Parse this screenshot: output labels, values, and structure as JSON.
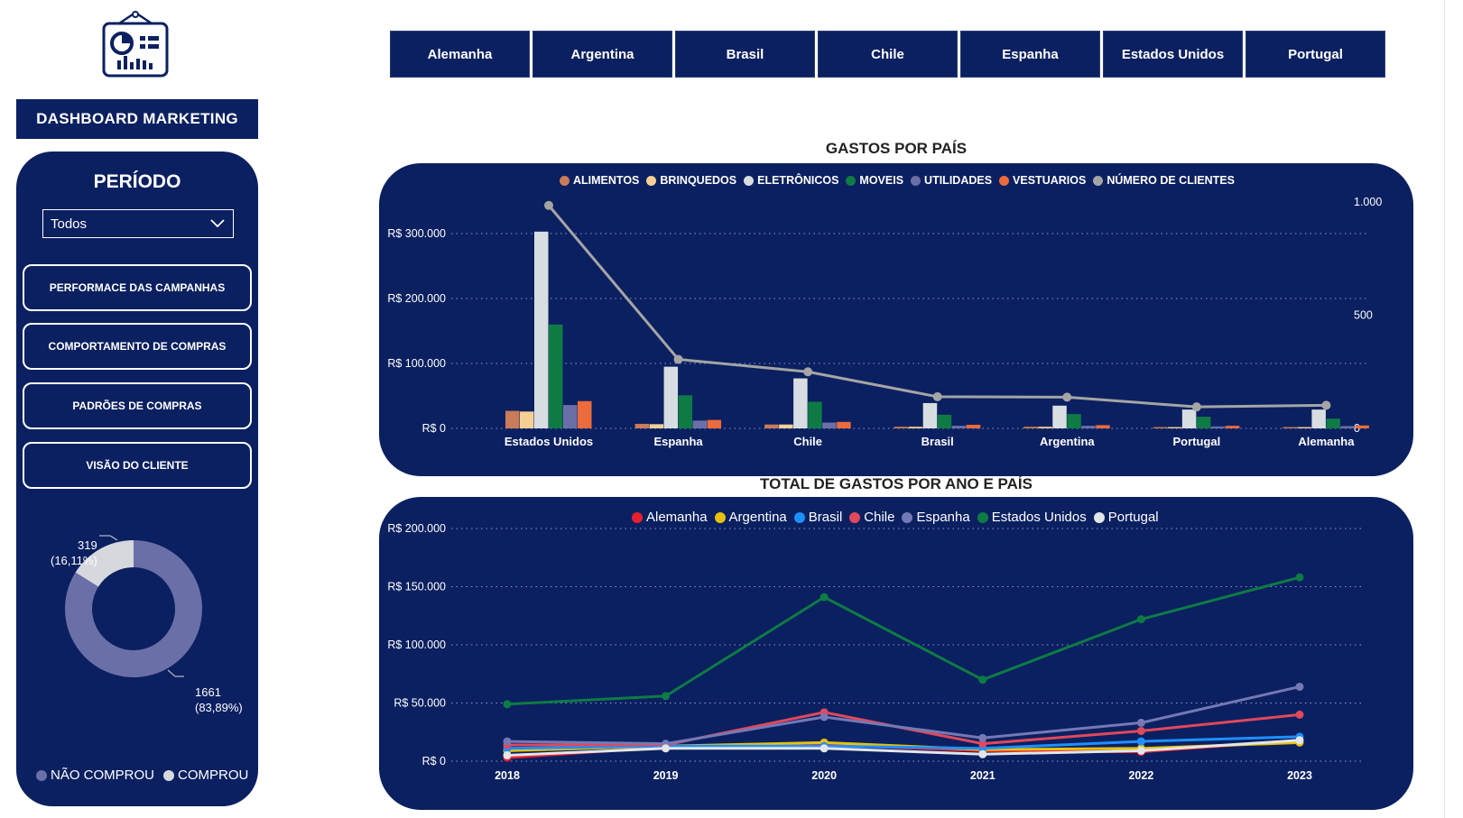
{
  "sidebar": {
    "title": "DASHBOARD MARKETING",
    "periodo_label": "PERÍODO",
    "periodo_value": "Todos",
    "nav": [
      {
        "label": "PERFORMACE DAS CAMPANHAS"
      },
      {
        "label": "COMPORTAMENTO DE COMPRAS"
      },
      {
        "label": "PADRÕES DE COMPRAS"
      },
      {
        "label": "VISÃO DO CLIENTE"
      }
    ],
    "donut": {
      "slices": [
        {
          "name": "NÃO COMPROU",
          "value": 1661,
          "label": "1661",
          "pct": "(83,89%)",
          "color": "#6b6fa8"
        },
        {
          "name": "COMPROU",
          "value": 319,
          "label": "319",
          "pct": "(16,11%)",
          "color": "#d5d9dd"
        }
      ]
    }
  },
  "tabs": [
    "Alemanha",
    "Argentina",
    "Brasil",
    "Chile",
    "Espanha",
    "Estados Unidos",
    "Portugal"
  ],
  "charts": {
    "bar": {
      "title": "GASTOS POR PAÍS"
    },
    "line": {
      "title": "TOTAL DE GASTOS POR ANO E PAÍS"
    }
  },
  "chart_data": [
    {
      "type": "bar",
      "title": "GASTOS POR PAÍS",
      "categories": [
        "Estados Unidos",
        "Espanha",
        "Chile",
        "Brasil",
        "Argentina",
        "Portugal",
        "Alemanha"
      ],
      "series": [
        {
          "name": "ALIMENTOS",
          "color": "#c97b5a",
          "values": [
            27000,
            7000,
            6000,
            2500,
            2500,
            2000,
            2000
          ]
        },
        {
          "name": "BRINQUEDOS",
          "color": "#f5cf95",
          "values": [
            26000,
            6500,
            6000,
            2500,
            2500,
            2000,
            2000
          ]
        },
        {
          "name": "ELETRÔNICOS",
          "color": "#d8dde2",
          "values": [
            303000,
            95000,
            77000,
            39000,
            35000,
            29000,
            29000
          ]
        },
        {
          "name": "MOVEIS",
          "color": "#0e7b45",
          "values": [
            160000,
            51000,
            41000,
            21000,
            22000,
            18000,
            15000
          ]
        },
        {
          "name": "UTILIDADES",
          "color": "#6b6fa8",
          "values": [
            36000,
            12000,
            9000,
            4000,
            4000,
            3000,
            3500
          ]
        },
        {
          "name": "VESTUARIOS",
          "color": "#ec6b3c",
          "values": [
            42000,
            13000,
            10000,
            5500,
            5000,
            4000,
            4500
          ]
        }
      ],
      "line_series": {
        "name": "NÚMERO DE CLIENTES",
        "color": "#a5a5a5",
        "values": [
          985,
          305,
          250,
          140,
          138,
          95,
          102
        ]
      },
      "ylim": [
        0,
        300000
      ],
      "yticks": [
        {
          "v": 0,
          "label": "R$ 0"
        },
        {
          "v": 100000,
          "label": "R$ 100.000"
        },
        {
          "v": 200000,
          "label": "R$ 200.000"
        },
        {
          "v": 300000,
          "label": "R$ 300.000"
        }
      ],
      "y2lim": [
        0,
        1000
      ],
      "y2ticks": [
        {
          "v": 0,
          "label": "0"
        },
        {
          "v": 500,
          "label": "500"
        },
        {
          "v": 1000,
          "label": "1.000"
        }
      ],
      "legend": "top-center",
      "grid": true
    },
    {
      "type": "line",
      "title": "TOTAL DE GASTOS POR ANO E PAÍS",
      "x": [
        "2018",
        "2019",
        "2020",
        "2021",
        "2022",
        "2023"
      ],
      "series": [
        {
          "name": "Alemanha",
          "color": "#e8212f",
          "values": [
            3000,
            12000,
            14000,
            9000,
            8000,
            18000
          ]
        },
        {
          "name": "Argentina",
          "color": "#e6c20e",
          "values": [
            9000,
            13000,
            16000,
            10000,
            11000,
            16000
          ]
        },
        {
          "name": "Brasil",
          "color": "#1f8fff",
          "values": [
            11000,
            13000,
            13000,
            11000,
            17000,
            21000
          ]
        },
        {
          "name": "Chile",
          "color": "#e0485c",
          "values": [
            14000,
            14000,
            42000,
            15000,
            26000,
            40000
          ]
        },
        {
          "name": "Espanha",
          "color": "#7479b5",
          "values": [
            17000,
            15000,
            38000,
            20000,
            33000,
            64000
          ]
        },
        {
          "name": "Estados Unidos",
          "color": "#0e7b45",
          "values": [
            49000,
            56000,
            141000,
            70000,
            122000,
            158000
          ]
        },
        {
          "name": "Portugal",
          "color": "#e3e6e9",
          "values": [
            5000,
            11000,
            11000,
            6000,
            9000,
            18000
          ]
        }
      ],
      "ylim": [
        0,
        200000
      ],
      "yticks": [
        {
          "v": 0,
          "label": "R$ 0"
        },
        {
          "v": 50000,
          "label": "R$ 50.000"
        },
        {
          "v": 100000,
          "label": "R$ 100.000"
        },
        {
          "v": 150000,
          "label": "R$ 150.000"
        },
        {
          "v": 200000,
          "label": "R$ 200.000"
        }
      ],
      "legend": "top-center",
      "grid": true
    }
  ]
}
